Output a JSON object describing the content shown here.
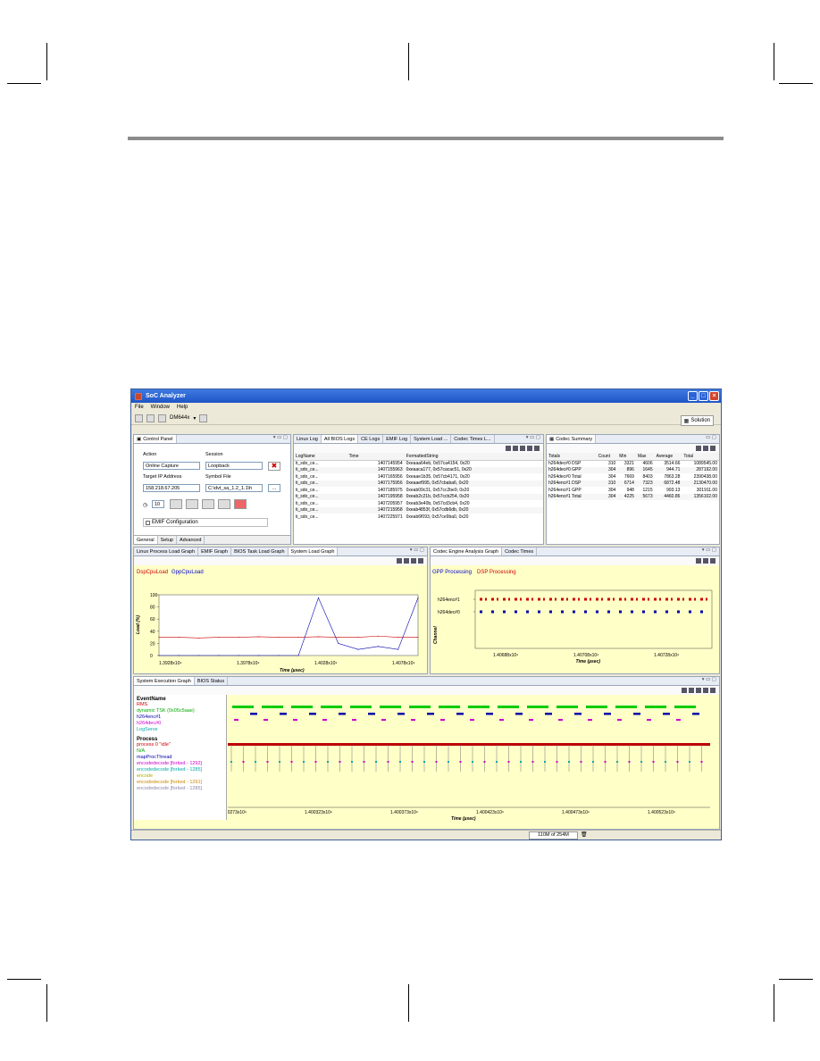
{
  "window": {
    "title": "SoC Analyzer",
    "min": "_",
    "max": "□",
    "close": "×"
  },
  "menu": [
    "File",
    "Window",
    "Help"
  ],
  "toolbar": {
    "device": "DM644x",
    "solution": "Solution"
  },
  "control_panel": {
    "tab": "Control Panel",
    "action_label": "Action",
    "session_label": "Session",
    "action_value": "Online Capture",
    "session_value": "Loopback",
    "ip_label": "Target IP Address",
    "symbol_label": "Symbol File",
    "ip_value": "158.218.67.205",
    "symbol_value": "C:\\dvt_sa_1.2_1.1\\h",
    "browse": "...",
    "counter": "10",
    "emif": "EMIF Configuration",
    "bottom_tabs": [
      "General",
      "Setup",
      "Advanced"
    ]
  },
  "logs": {
    "tabs": [
      "Linux Log",
      "All BIOS Logs",
      "CE Logs",
      "EMIF Log",
      "System Load ...",
      "Codec Times L..."
    ],
    "columns": [
      "LogName",
      "Time",
      "FormattedString"
    ],
    "rows": [
      [
        "ti_sdo_ce...",
        "1407145954",
        "0xeaaa64eb, 0x57ca4154, 0x20"
      ],
      [
        "ti_sdo_ce...",
        "1407155963",
        "0xeaaca177, 0x57cacac51, 0x20"
      ],
      [
        "ti_sdo_ce...",
        "1407165956",
        "0xeaae1b35, 0x57cb4171, 0x20"
      ],
      [
        "ti_sdo_ce...",
        "1407175956",
        "0xeaaef995, 0x57cbaba6, 0x20"
      ],
      [
        "ti_sdo_ce...",
        "1407185975",
        "0xeab09c31, 0x57cc2be9, 0x20"
      ],
      [
        "ti_sdo_ce...",
        "1407195958",
        "0xeab2c21b, 0x57ccb254, 0x20"
      ],
      [
        "ti_sdo_ce...",
        "1407205957",
        "0xeab3e40b, 0x57cd3cb4, 0x20"
      ],
      [
        "ti_sdo_ce...",
        "1407215958",
        "0xeab4853f, 0x57cdb6db, 0x20"
      ],
      [
        "ti_sdo_ce...",
        "1407225971",
        "0xeab6f093, 0x57ce9ba0, 0x20"
      ]
    ]
  },
  "codec_summary": {
    "tab": "Codec Summary",
    "columns": [
      "Totals",
      "Count",
      "Min",
      "Max",
      "Average",
      "Total"
    ],
    "rows": [
      [
        "h264dec#0 DSP",
        "310",
        "3321",
        "4606",
        "3514.66",
        "1089545.00"
      ],
      [
        "h264dec#0 GPP",
        "304",
        "896",
        "1645",
        "944.71",
        "287192.00"
      ],
      [
        "h264dec#0 Total",
        "304",
        "7669",
        "8403",
        "7863.28",
        "2390438.00"
      ],
      [
        "h264enc#1 DSP",
        "310",
        "6714",
        "7323",
        "6872.48",
        "2130470.00"
      ],
      [
        "h264enc#1 GPP",
        "304",
        "948",
        "1215",
        "993.13",
        "301911.00"
      ],
      [
        "h264enc#1 Total",
        "304",
        "4225",
        "5673",
        "4460.86",
        "1356102.00"
      ]
    ]
  },
  "load_graph": {
    "tabs": [
      "Linux Process Load Graph",
      "EMIF Graph",
      "BIOS Task Load Graph",
      "System Load Graph"
    ],
    "legend": [
      "DspCpuLoad",
      "GppCpuLoad"
    ],
    "ylabel": "Load (%)",
    "xlabel": "Time (µsec)",
    "yticks": [
      "100",
      "80",
      "60",
      "40",
      "20",
      "0"
    ],
    "xticks": [
      "1.3928x10⁹",
      "1.3978x10⁹",
      "1.4028x10⁹",
      "1.4078x10⁹"
    ]
  },
  "codec_graph": {
    "tabs": [
      "Codec Engine Analysis Graph",
      "Codec Times"
    ],
    "legend": [
      "GPP Processing",
      "DSP Processing"
    ],
    "channels": [
      "h264enc#1",
      "h264dec#0"
    ],
    "ylabel": "Channel",
    "xlabel": "Time (µsec)",
    "xticks": [
      "1.40688x10⁹",
      "1.40708x10⁹",
      "1.40728x10⁹"
    ]
  },
  "exec_graph": {
    "tabs": [
      "System Execution Graph",
      "BIOS Status"
    ],
    "event_header": "EventName",
    "events": [
      "RMS",
      "dynamic TSK (0x05c5aae)",
      "h264enc#1",
      "h264dec#0",
      "LogServe"
    ],
    "process_header": "Process",
    "processes": [
      "process 0 \"idle\"",
      "N/A",
      "mapProcThread",
      "encodedecode [forked - 1292]",
      "encodedecode [forked - 1285]",
      "encode",
      "encodedecode [forked - 1291]",
      "encodedecode [forked - 1285]"
    ],
    "xticks": [
      "1.400273x10⁹",
      "1.400323x10⁹",
      "1.400373x10⁹",
      "1.400423x10⁹",
      "1.400473x10⁹",
      "1.400523x10⁹"
    ],
    "xlabel": "Time (µsec)"
  },
  "status": {
    "memory": "110M of 254M"
  },
  "chart_data": [
    {
      "type": "line",
      "title": "",
      "xlabel": "Time (µsec)",
      "ylabel": "Load (%)",
      "ylim": [
        0,
        100
      ],
      "series": [
        {
          "name": "DspCpuLoad",
          "values": [
            30,
            30,
            29,
            30,
            30,
            31,
            30,
            30,
            31,
            30,
            30,
            32,
            30,
            30
          ]
        },
        {
          "name": "GppCpuLoad",
          "values": [
            0,
            0,
            0,
            0,
            0,
            0,
            0,
            0,
            95,
            20,
            10,
            15,
            10,
            95
          ]
        }
      ]
    },
    {
      "type": "scatter",
      "title": "",
      "xlabel": "Time (µsec)",
      "ylabel": "Channel",
      "categories": [
        "h264enc#1",
        "h264dec#0"
      ],
      "series": [
        {
          "name": "GPP Processing",
          "values": []
        },
        {
          "name": "DSP Processing",
          "values": []
        }
      ]
    }
  ]
}
